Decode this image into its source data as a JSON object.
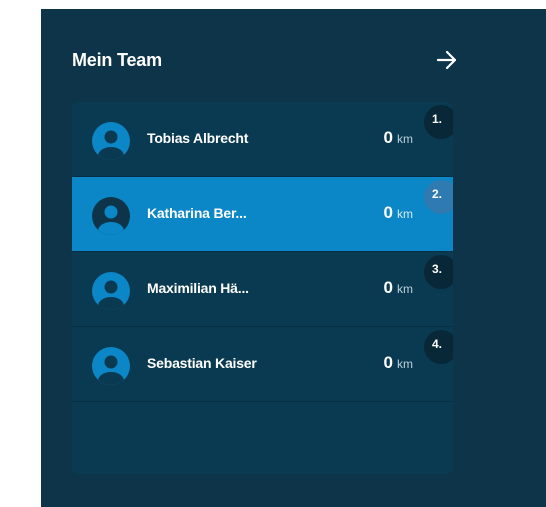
{
  "team": {
    "title": "Mein Team",
    "members": [
      {
        "rank": "1.",
        "name": "Tobias Albrecht",
        "distance": "0",
        "unit": "km",
        "active": false
      },
      {
        "rank": "2.",
        "name": "Katharina Ber...",
        "distance": "0",
        "unit": "km",
        "active": true
      },
      {
        "rank": "3.",
        "name": "Maximilian Hä...",
        "distance": "0",
        "unit": "km",
        "active": false
      },
      {
        "rank": "4.",
        "name": "Sebastian Kaiser",
        "distance": "0",
        "unit": "km",
        "active": false
      }
    ]
  },
  "icons": {
    "header_arrow": "arrow-right-icon",
    "member_avatar": "user-avatar-icon"
  },
  "colors": {
    "panel_bg": "#0d3448",
    "card_bg": "#0a3a51",
    "active_row": "#0b86c6",
    "avatar_default": "#0b86c6",
    "avatar_active": "#0d3448",
    "rank_badge": "#082737",
    "rank_badge_active": "#2f7ab0"
  }
}
